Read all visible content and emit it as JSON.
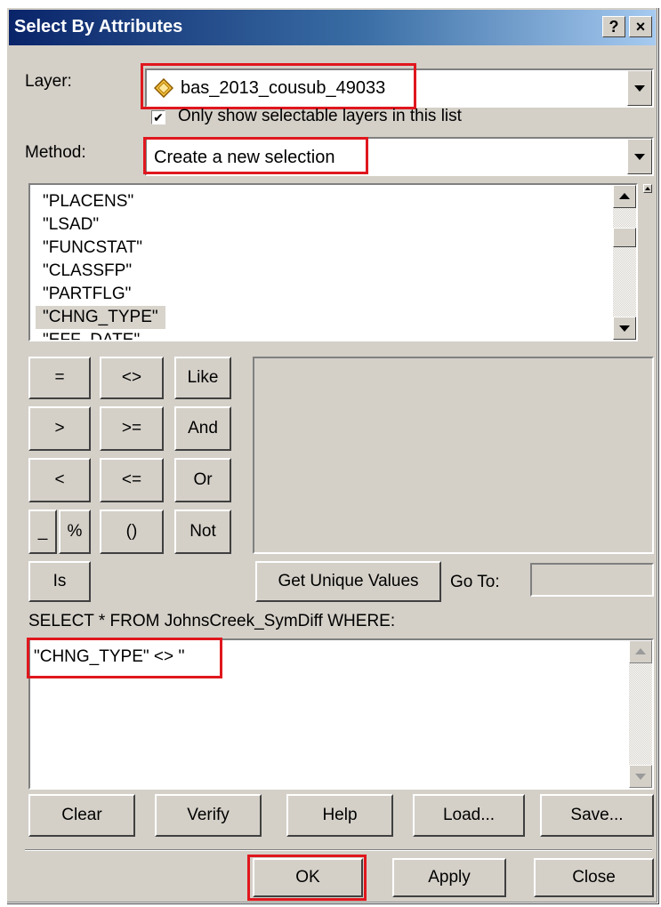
{
  "window": {
    "title": "Select By Attributes",
    "help_button": "?",
    "close_button": "×"
  },
  "layer": {
    "label": "Layer:",
    "value": "bas_2013_cousub_49033",
    "icon": "layer-diamond-icon",
    "checkbox_label": "Only show selectable layers in this list",
    "checkbox_checked": true
  },
  "method": {
    "label": "Method:",
    "value": "Create a new selection"
  },
  "fields": [
    "\"PLACENS\"",
    "\"LSAD\"",
    "\"FUNCSTAT\"",
    "\"CLASSFP\"",
    "\"PARTFLG\"",
    "\"CHNG_TYPE\"",
    "\"EFF_DATE\""
  ],
  "selected_field": "\"CHNG_TYPE\"",
  "operators": {
    "eq": "=",
    "ne": "<>",
    "like": "Like",
    "gt": ">",
    "ge": ">=",
    "and": "And",
    "lt": "<",
    "le": "<=",
    "or": "Or",
    "underscore": "_",
    "percent": "%",
    "parens": "()",
    "not": "Not",
    "is": "Is"
  },
  "unique_values": {
    "get_button": "Get Unique Values",
    "goto_label": "Go To:",
    "goto_value": ""
  },
  "query": {
    "prefix": "SELECT * FROM JohnsCreek_SymDiff WHERE:",
    "expression": "\"CHNG_TYPE\" <> ''"
  },
  "action_buttons": {
    "clear": "Clear",
    "verify": "Verify",
    "help": "Help",
    "load": "Load...",
    "save": "Save..."
  },
  "dialog_buttons": {
    "ok": "OK",
    "apply": "Apply",
    "close": "Close"
  },
  "colors": {
    "highlight_red": "#e0171e",
    "dialog_face": "#d4d0c8",
    "titlebar_dark": "#0a246a"
  }
}
